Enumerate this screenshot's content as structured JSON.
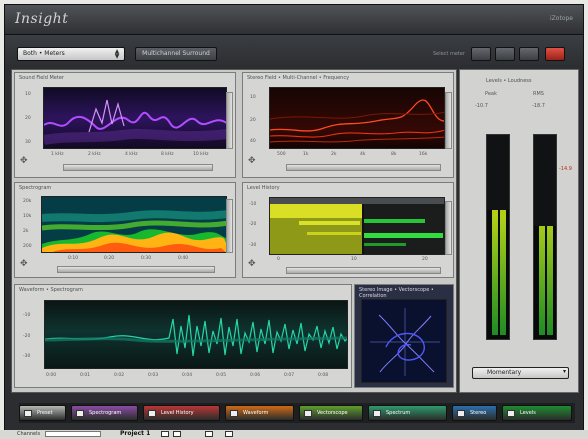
{
  "window": {
    "title": "Insight",
    "brand": "iZotope"
  },
  "toolbar": {
    "preset": "Both • Meters",
    "layout_button": "Multichannel Surround",
    "label": "Select meter"
  },
  "panels": {
    "top_left": {
      "title": "Sound Field Meter",
      "y_ticks": [
        "10",
        "20",
        "30"
      ],
      "x_ticks": [
        "1 kHz",
        "2 kHz",
        "4 kHz",
        "8 kHz",
        "10 kHz"
      ]
    },
    "top_right": {
      "title": "Stereo Field • Multi-Channel • Frequency",
      "y_ticks": [
        "10",
        "20",
        "40"
      ],
      "x_ticks": [
        "500",
        "1k",
        "2k",
        "4k",
        "8k",
        "16k"
      ]
    },
    "middle_left": {
      "title": "Spectrogram",
      "y_ticks": [
        "20k",
        "10k",
        "2k",
        "200"
      ],
      "x_ticks": [
        "0:10",
        "0:20",
        "0:30",
        "0:40"
      ]
    },
    "middle_right": {
      "title": "Level History",
      "y_ticks": [
        "-10",
        "-20",
        "-30"
      ],
      "x_ticks": [
        "0",
        "10",
        "20"
      ]
    },
    "bottom": {
      "title": "Waveform • Spectrogram",
      "y_ticks": [
        "-10",
        "-20",
        "-30"
      ],
      "x_ticks": [
        "0:00",
        "0:01",
        "0:02",
        "0:03",
        "0:04",
        "0:05",
        "0:06",
        "0:07",
        "0:08"
      ]
    },
    "vector": {
      "title": "Stereo Image • Vectorscope • Correlation"
    }
  },
  "meters": {
    "title": "Levels • Loudness",
    "left_label": "Peak",
    "right_label": "RMS",
    "left_values": "-10.7",
    "right_values": "-18.7",
    "marker": "-14.9",
    "left_level": 0.62,
    "right_level": 0.54,
    "mode": "Momentary"
  },
  "tabs": [
    {
      "label": "Preset",
      "color": "#b7b8b5"
    },
    {
      "label": "Spectrogram",
      "color": "#8b4ca6"
    },
    {
      "label": "Level History",
      "color": "#b93636"
    },
    {
      "label": "Waveform",
      "color": "#cf6b17"
    },
    {
      "label": "Vectorscope",
      "color": "#5f9f2f"
    },
    {
      "label": "Spectrum",
      "color": "#2f9a6d"
    },
    {
      "label": "Stereo",
      "color": "#2d6fae"
    },
    {
      "label": "Levels",
      "color": "#1f8b32"
    }
  ],
  "status": {
    "label": "Channels",
    "project": "Project 1"
  },
  "colors": {
    "window": "#2b2d30",
    "red_button": "#c9352a",
    "meter_fill": "#9bc91e"
  }
}
